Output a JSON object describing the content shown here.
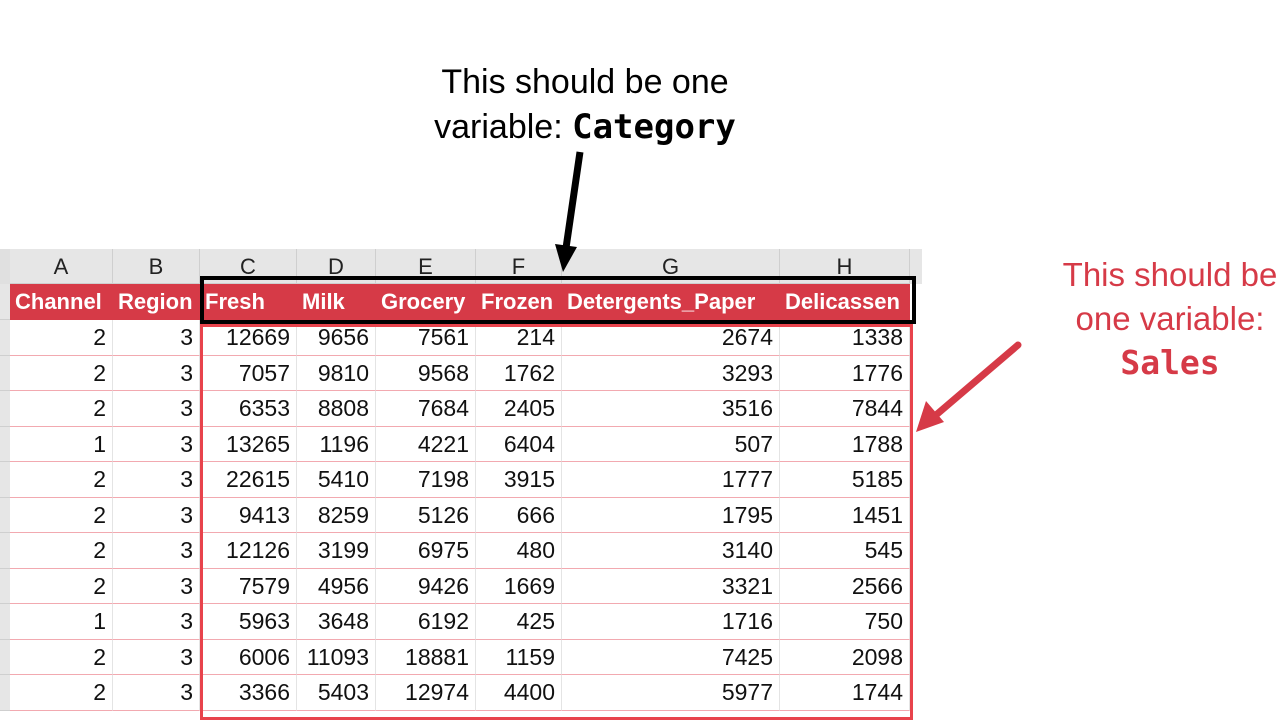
{
  "column_letters": [
    "A",
    "B",
    "C",
    "D",
    "E",
    "F",
    "G",
    "H"
  ],
  "headers": [
    "Channel",
    "Region",
    "Fresh",
    "Milk",
    "Grocery",
    "Frozen",
    "Detergents_Paper",
    "Delicassen"
  ],
  "rows": [
    [
      "2",
      "3",
      "12669",
      "9656",
      "7561",
      "214",
      "2674",
      "1338"
    ],
    [
      "2",
      "3",
      "7057",
      "9810",
      "9568",
      "1762",
      "3293",
      "1776"
    ],
    [
      "2",
      "3",
      "6353",
      "8808",
      "7684",
      "2405",
      "3516",
      "7844"
    ],
    [
      "1",
      "3",
      "13265",
      "1196",
      "4221",
      "6404",
      "507",
      "1788"
    ],
    [
      "2",
      "3",
      "22615",
      "5410",
      "7198",
      "3915",
      "1777",
      "5185"
    ],
    [
      "2",
      "3",
      "9413",
      "8259",
      "5126",
      "666",
      "1795",
      "1451"
    ],
    [
      "2",
      "3",
      "12126",
      "3199",
      "6975",
      "480",
      "3140",
      "545"
    ],
    [
      "2",
      "3",
      "7579",
      "4956",
      "9426",
      "1669",
      "3321",
      "2566"
    ],
    [
      "1",
      "3",
      "5963",
      "3648",
      "6192",
      "425",
      "1716",
      "750"
    ],
    [
      "2",
      "3",
      "6006",
      "11093",
      "18881",
      "1159",
      "7425",
      "2098"
    ],
    [
      "2",
      "3",
      "3366",
      "5403",
      "12974",
      "4400",
      "5977",
      "1744"
    ]
  ],
  "annotations": {
    "category": {
      "line1": "This should be one",
      "line2_prefix": "variable: ",
      "line2_code": "Category",
      "color": "#000000"
    },
    "sales": {
      "line1": "This should be",
      "line2": "one variable:",
      "line3_code": "Sales",
      "color": "#d63a47"
    }
  },
  "colors": {
    "header_bg": "#d63a47",
    "header_text": "#ffffff",
    "row_border": "#f2a9b0",
    "sales_box": "#e8434c"
  }
}
